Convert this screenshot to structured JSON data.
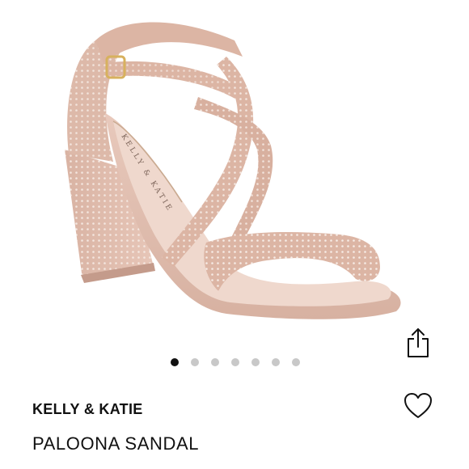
{
  "product": {
    "brand": "KELLY & KATIE",
    "name": "PALOONA SANDAL",
    "insole_print": "KELLY & KATIE",
    "image_count": 7,
    "active_image_index": 0
  },
  "actions": {
    "share_icon": "share-icon",
    "favorite_icon": "heart-outline-icon"
  },
  "colors": {
    "sandal": "#e5c3b5",
    "sandal_shadow": "#c99f8e",
    "rhinestone": "#f3e6df",
    "dot_active": "#111111",
    "dot_inactive": "#c8c8c8"
  }
}
